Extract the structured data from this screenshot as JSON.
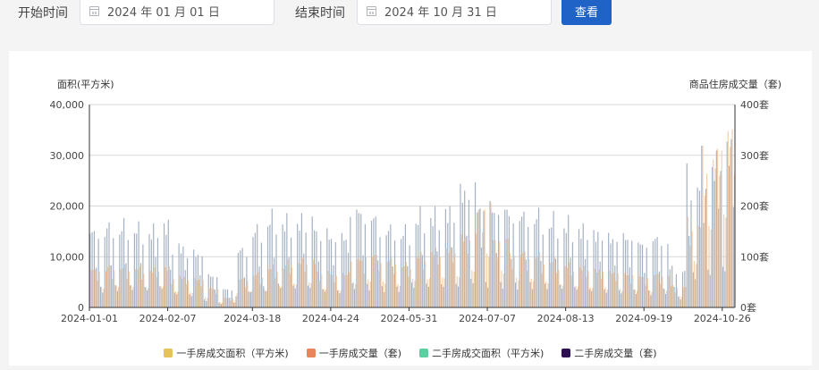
{
  "filters": {
    "start_label": "开始时间",
    "start_value": "2024 年 01 月 01 日",
    "end_label": "结束时间",
    "end_value": "2024 年 10 月 31 日",
    "query_label": "查看"
  },
  "colors": {
    "new_area": "#e5c35a",
    "new_count": "#e8855a",
    "second_area": "#5ccfa0",
    "second_count": "#2d0f52",
    "bar_area_fill": "#a4b1c3",
    "bar_count_fill": "#f2cfae",
    "button": "#1f63c7"
  },
  "chart_data": {
    "type": "bar",
    "left_axis": {
      "name": "面积(平方米)",
      "min": 0,
      "max": 40000,
      "ticks": [
        "0",
        "10,000",
        "20,000",
        "30,000",
        "40,000"
      ]
    },
    "right_axis": {
      "name": "商品住房成交量（套)",
      "min": 0,
      "max": 400,
      "ticks": [
        "0套",
        "100套",
        "200套",
        "300套",
        "400套"
      ]
    },
    "x_axis": {
      "start": "2024-01-01",
      "end": "2024-10-31",
      "tick_labels": [
        "2024-01-01",
        "2024-02-07",
        "2024-03-18",
        "2024-04-24",
        "2024-05-31",
        "2024-07-07",
        "2024-08-13",
        "2024-09-19",
        "2024-10-26"
      ]
    },
    "legend": [
      {
        "name": "一手房成交面积（平方米)",
        "color_key": "new_area"
      },
      {
        "name": "一手房成交量（套)",
        "color_key": "new_count"
      },
      {
        "name": "二手房成交面积（平方米)",
        "color_key": "second_area"
      },
      {
        "name": "二手房成交量（套)",
        "color_key": "second_count"
      }
    ],
    "grid": true,
    "legend_position": "bottom",
    "weekly_area": [
      16500,
      17500,
      17800,
      17000,
      18500,
      13500,
      12000,
      7000,
      4000,
      12500,
      16800,
      19500,
      18800,
      19500,
      16500,
      15500,
      21000,
      19500,
      17000,
      16500,
      20000,
      20500,
      21500,
      26000,
      22500,
      21500,
      20000,
      20000,
      19000,
      18500,
      17500,
      16500,
      15500,
      15500,
      14000,
      15000,
      8500,
      28500,
      32000,
      36000
    ],
    "weekly_count": [
      80,
      85,
      85,
      80,
      85,
      65,
      60,
      40,
      20,
      60,
      70,
      85,
      95,
      100,
      75,
      70,
      100,
      110,
      100,
      90,
      110,
      120,
      125,
      150,
      215,
      145,
      115,
      110,
      100,
      90,
      85,
      80,
      75,
      70,
      65,
      70,
      45,
      180,
      320,
      370
    ]
  }
}
